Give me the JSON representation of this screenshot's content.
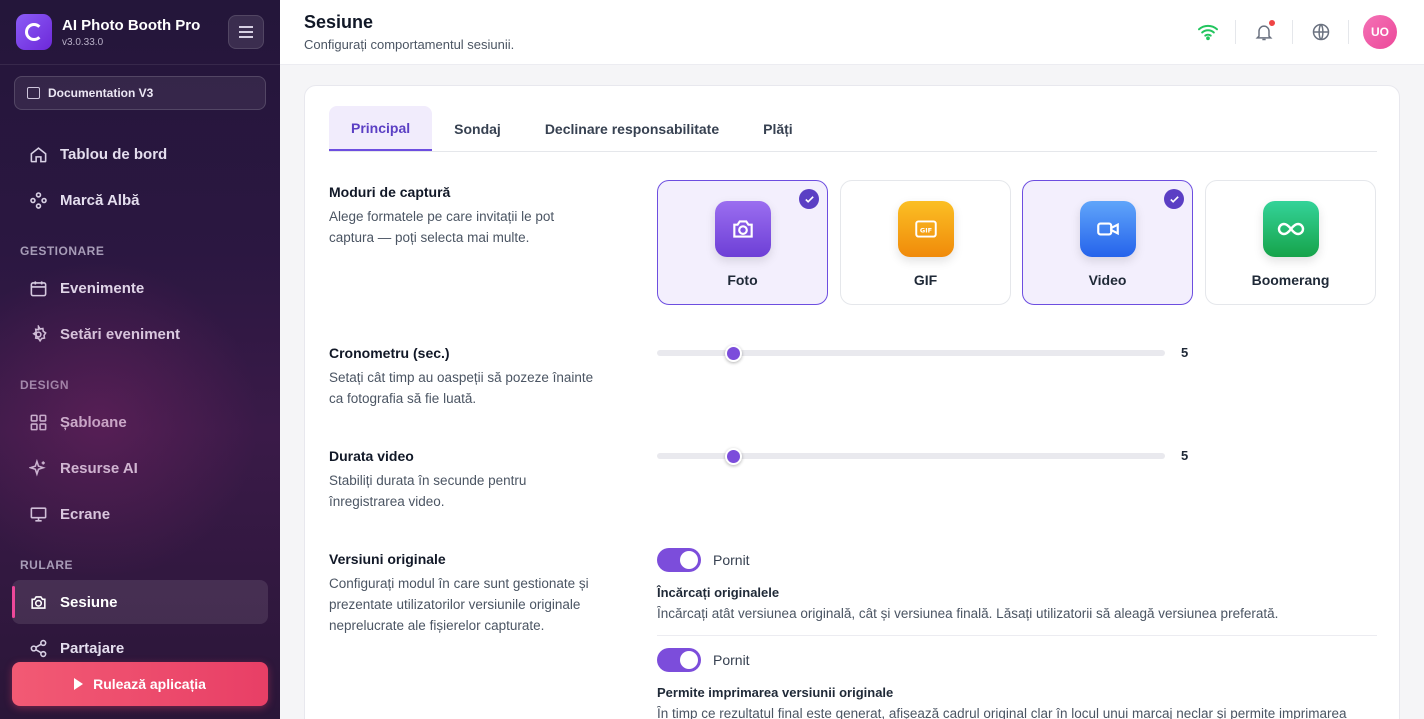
{
  "app": {
    "name": "AI Photo Booth Pro",
    "version": "v3.0.33.0"
  },
  "workspace": {
    "label": "Documentation V3"
  },
  "nav": {
    "dashboard": "Tablou de bord",
    "whitelabel": "Marcă Albă",
    "section_manage": "GESTIONARE",
    "events": "Evenimente",
    "event_settings": "Setări eveniment",
    "section_design": "DESIGN",
    "templates": "Șabloane",
    "ai_resources": "Resurse AI",
    "screens": "Ecrane",
    "section_run": "RULARE",
    "session": "Sesiune",
    "sharing": "Partajare"
  },
  "run_button": "Rulează aplicația",
  "header": {
    "title": "Sesiune",
    "subtitle": "Configurați comportamentul sesiunii.",
    "avatar": "UO"
  },
  "tabs": [
    "Principal",
    "Sondaj",
    "Declinare responsabilitate",
    "Plăți"
  ],
  "capture": {
    "title": "Moduri de captură",
    "desc": "Alege formatele pe care invitații le pot captura — poți selecta mai multe.",
    "modes": [
      {
        "label": "Foto",
        "selected": true,
        "icon": "camera-icon",
        "color": "#7c4ddb"
      },
      {
        "label": "GIF",
        "selected": false,
        "icon": "gif-icon",
        "color": "#f59e0b"
      },
      {
        "label": "Video",
        "selected": true,
        "icon": "video-icon",
        "color": "#3b82f6"
      },
      {
        "label": "Boomerang",
        "selected": false,
        "icon": "infinity-icon",
        "color": "#22c55e"
      }
    ]
  },
  "countdown": {
    "title": "Cronometru (sec.)",
    "desc": "Setați cât timp au oaspeții să pozeze înainte ca fotografia să fie luată.",
    "value": "5"
  },
  "video_duration": {
    "title": "Durata video",
    "desc": "Stabiliți durata în secunde pentru înregistrarea video.",
    "value": "5"
  },
  "originals": {
    "title": "Versiuni originale",
    "desc": "Configurați modul în care sunt gestionate și prezentate utilizatorilor versiunile originale neprelucrate ale fișierelor capturate.",
    "opt1": {
      "state": "Pornit",
      "title": "Încărcați originalele",
      "desc": "Încărcați atât versiunea originală, cât și versiunea finală. Lăsați utilizatorii să aleagă versiunea preferată."
    },
    "opt2": {
      "state": "Pornit",
      "title": "Permite imprimarea versiunii originale",
      "desc": "În timp ce rezultatul final este generat, afișează cadrul original clar în locul unui marcaj neclar și permite imprimarea"
    }
  }
}
